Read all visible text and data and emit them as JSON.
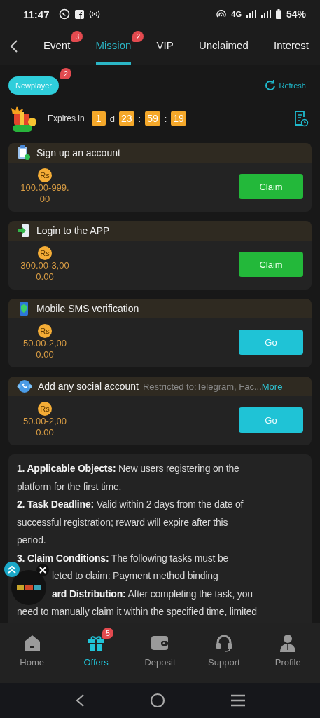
{
  "status_bar": {
    "time": "11:47",
    "network": "4G",
    "battery": "54%"
  },
  "tabs": [
    {
      "label": "Event",
      "badge": "3",
      "selected": false
    },
    {
      "label": "Mission",
      "badge": "2",
      "selected": true
    },
    {
      "label": "VIP",
      "selected": false
    },
    {
      "label": "Unclaimed",
      "selected": false
    },
    {
      "label": "Interest",
      "selected": false
    }
  ],
  "category": {
    "label": "Newplayer",
    "badge": "2",
    "selected": true
  },
  "refresh": "Refresh",
  "expiry": {
    "label": "Expires in",
    "days": "1",
    "day_unit": "d",
    "hours": "23",
    "minutes": "59",
    "seconds": "19",
    "separator": ":"
  },
  "tasks": [
    {
      "title": "Sign up an account",
      "currency": "Rs",
      "reward": "100.00-999.\n00",
      "button": {
        "label": "Claim",
        "kind": "claim"
      }
    },
    {
      "title": "Login to the APP",
      "currency": "Rs",
      "reward": "300.00-3,00\n0.00",
      "button": {
        "label": "Claim",
        "kind": "claim"
      }
    },
    {
      "title": "Mobile SMS verification",
      "currency": "Rs",
      "reward": "50.00-2,00\n0.00",
      "button": {
        "label": "Go",
        "kind": "go"
      }
    },
    {
      "title": "Add any social account",
      "restriction": "Restricted to:Telegram, Fac...",
      "more": "More",
      "currency": "Rs",
      "reward": "50.00-2,00\n0.00",
      "button": {
        "label": "Go",
        "kind": "go"
      }
    }
  ],
  "rules": [
    {
      "text": "**1. Applicable Objects:** New users registering on the",
      "covered": false
    },
    {
      "text": "platform for the first time.",
      "covered": false
    },
    {
      "text": "**2. Task Deadline:** Valid within 2 days from the date of",
      "covered": false
    },
    {
      "text": "successful registration; reward will expire after this",
      "covered": false
    },
    {
      "text": "period.",
      "covered": false
    },
    {
      "text": "**3. Claim Conditions:** The following tasks must be",
      "covered": false
    },
    {
      "text": "leted to claim: Payment method binding",
      "covered": true
    },
    {
      "text": "**ard Distribution:** After completing the task, you",
      "covered": true
    },
    {
      "text": "need to manually claim it within the specified time, limited",
      "covered": false
    }
  ],
  "nav": [
    {
      "label": "Home",
      "selected": false
    },
    {
      "label": "Offers",
      "badge": "5",
      "selected": true
    },
    {
      "label": "Deposit",
      "selected": false
    },
    {
      "label": "Support",
      "selected": false
    },
    {
      "label": "Profile",
      "selected": false
    }
  ]
}
